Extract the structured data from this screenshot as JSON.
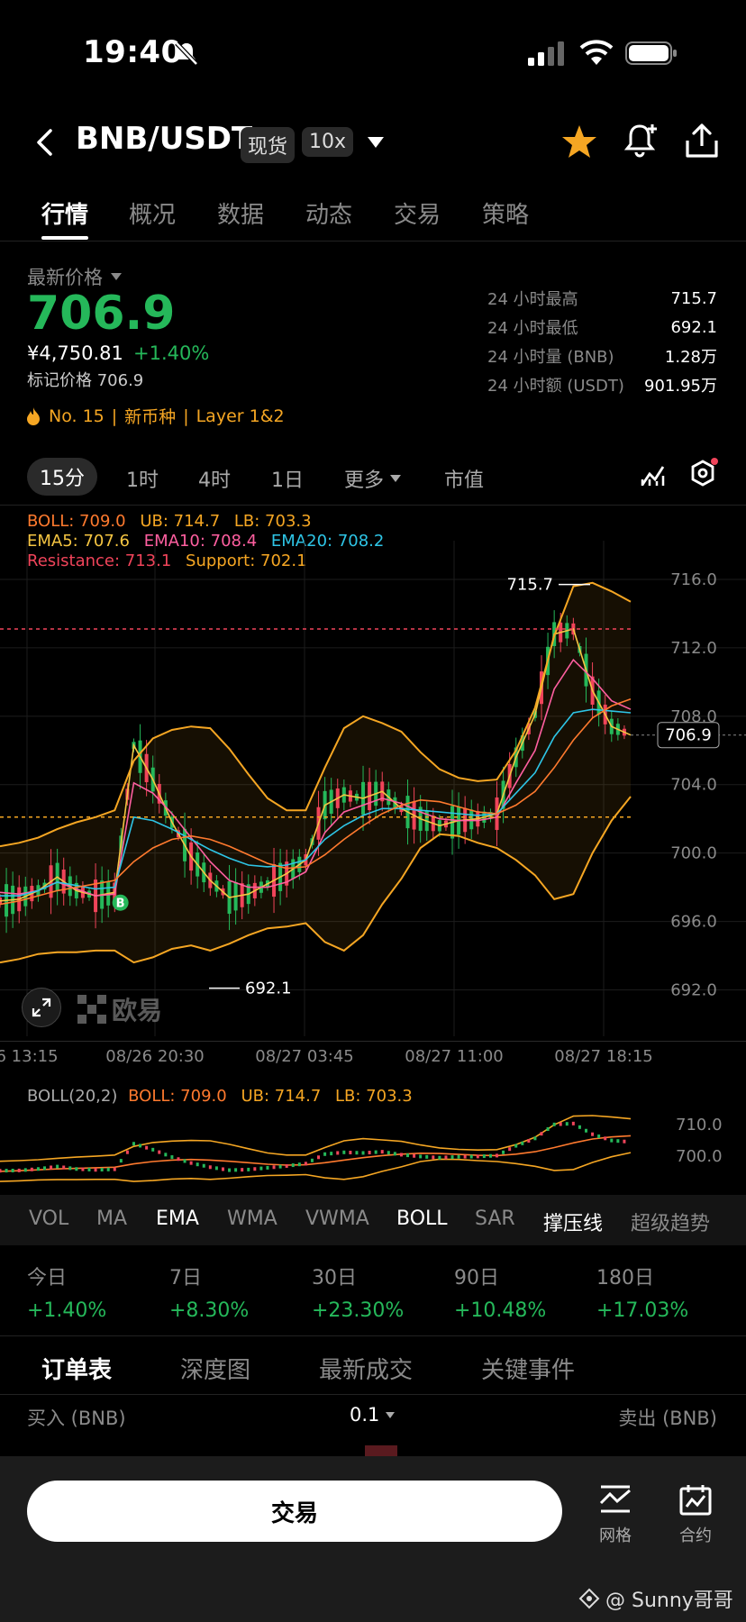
{
  "status_bar": {
    "time": "19:40"
  },
  "header": {
    "pair": "BNB/USDT",
    "badge_spot": "现货",
    "badge_leverage": "10x"
  },
  "tabs": [
    {
      "label": "行情",
      "active": true
    },
    {
      "label": "概况"
    },
    {
      "label": "数据"
    },
    {
      "label": "动态"
    },
    {
      "label": "交易"
    },
    {
      "label": "策略"
    }
  ],
  "price": {
    "label": "最新价格",
    "value": "706.9",
    "cny": "¥4,750.81",
    "change": "+1.40%",
    "mark": "标记价格 706.9",
    "tags": [
      "No. 15",
      "新币种",
      "Layer 1&2"
    ]
  },
  "stats": [
    {
      "label": "24 小时最高",
      "value": "715.7"
    },
    {
      "label": "24 小时最低",
      "value": "692.1"
    },
    {
      "label": "24 小时量 (BNB)",
      "value": "1.28万"
    },
    {
      "label": "24 小时额 (USDT)",
      "value": "901.95万"
    }
  ],
  "timeframes": {
    "active": "15分",
    "items": [
      "1时",
      "4时",
      "1日"
    ],
    "more": "更多",
    "mcap": "市值"
  },
  "legend": {
    "boll": "BOLL: 709.0",
    "ub": "UB: 714.7",
    "lb": "LB: 703.3",
    "ema5": "EMA5: 707.6",
    "ema10": "EMA10: 708.4",
    "ema20": "EMA20: 708.2",
    "resistance": "Resistance: 713.1",
    "support": "Support: 702.1"
  },
  "chart_data": {
    "type": "line",
    "y_ticks": [
      "716.0",
      "712.0",
      "708.0",
      "704.0",
      "700.0",
      "696.0",
      "692.0"
    ],
    "ylim": [
      691.5,
      717
    ],
    "x_ticks": [
      "6 13:15",
      "08/26 20:30",
      "08/27 03:45",
      "08/27 11:00",
      "08/27 18:15"
    ],
    "high_label": "715.7",
    "low_label": "692.1",
    "current_price": "706.9",
    "resistance": 713.1,
    "support": 702.1,
    "series": [
      {
        "name": "EMA5",
        "color": "#f5c542",
        "values": [
          697.2,
          697.3,
          697.8,
          698.6,
          697.8,
          697.5,
          697.7,
          706.3,
          704.3,
          701.8,
          699.8,
          698.4,
          697.4,
          697.6,
          698.2,
          698.8,
          699.6,
          702.8,
          703.4,
          703.2,
          703.6,
          702.6,
          702.0,
          701.6,
          701.9,
          702.0,
          702.3,
          705.6,
          708.1,
          712.8,
          713.1,
          709.5,
          707.4,
          706.9
        ]
      },
      {
        "name": "EMA10",
        "color": "#ff5fa0",
        "values": [
          697.7,
          697.6,
          697.8,
          698.3,
          697.9,
          697.5,
          697.6,
          704.1,
          703.5,
          702.3,
          700.9,
          699.5,
          698.4,
          698.0,
          698.0,
          698.3,
          698.9,
          701.2,
          702.4,
          702.8,
          703.2,
          702.9,
          702.4,
          702.0,
          701.9,
          701.9,
          702.1,
          704.1,
          706.0,
          709.6,
          711.3,
          710.2,
          708.9,
          708.4
        ]
      },
      {
        "name": "EMA20",
        "color": "#2ec5e6",
        "values": [
          697.5,
          697.5,
          697.8,
          698.3,
          698.1,
          697.9,
          698.0,
          702.1,
          701.9,
          701.4,
          700.8,
          700.2,
          699.7,
          699.3,
          699.2,
          699.3,
          699.6,
          700.8,
          701.6,
          702.2,
          702.6,
          702.6,
          702.5,
          702.4,
          702.3,
          702.2,
          702.3,
          703.5,
          704.7,
          706.8,
          708.2,
          708.4,
          708.3,
          708.2
        ]
      },
      {
        "name": "BOLL",
        "color": "#ff7a2e",
        "values": [
          697.0,
          697.2,
          697.5,
          697.8,
          698.0,
          698.2,
          698.4,
          699.5,
          700.3,
          700.8,
          701.0,
          700.8,
          700.4,
          699.9,
          699.4,
          699.1,
          699.2,
          699.9,
          700.8,
          701.6,
          702.3,
          702.8,
          703.1,
          703.0,
          702.7,
          702.4,
          702.3,
          702.8,
          703.6,
          705.0,
          706.6,
          707.9,
          708.6,
          709.0
        ]
      },
      {
        "name": "UB",
        "color": "#f5a623",
        "values": [
          700.4,
          700.6,
          700.9,
          701.4,
          701.8,
          702.1,
          702.5,
          705.4,
          706.7,
          707.2,
          707.4,
          707.3,
          706.1,
          704.6,
          703.2,
          702.5,
          702.5,
          705.0,
          707.3,
          708.0,
          707.6,
          707.1,
          705.9,
          704.9,
          704.4,
          704.2,
          704.3,
          706.0,
          708.5,
          712.7,
          715.6,
          715.8,
          715.3,
          714.7
        ]
      },
      {
        "name": "LB",
        "color": "#f5a623",
        "values": [
          693.6,
          693.8,
          694.1,
          694.2,
          694.2,
          694.3,
          694.3,
          693.6,
          693.9,
          694.4,
          694.6,
          694.3,
          694.7,
          695.2,
          695.6,
          695.7,
          695.9,
          694.8,
          694.3,
          695.2,
          697.0,
          698.5,
          700.3,
          701.1,
          701.0,
          700.6,
          700.3,
          699.6,
          698.7,
          697.3,
          697.6,
          700.0,
          701.9,
          703.3
        ]
      }
    ]
  },
  "sub_indicator": {
    "name": "BOLL(20,2)",
    "boll": "BOLL: 709.0",
    "ub": "UB: 714.7",
    "lb": "LB: 703.3",
    "ticks": [
      "710.0",
      "700.0"
    ]
  },
  "indicator_tabs": [
    {
      "label": "VOL"
    },
    {
      "label": "MA"
    },
    {
      "label": "EMA",
      "active": true
    },
    {
      "label": "WMA"
    },
    {
      "label": "VWMA"
    },
    {
      "label": "BOLL",
      "active": true
    },
    {
      "label": "SAR"
    },
    {
      "label": "撑压线",
      "active": true
    },
    {
      "label": "超级趋势"
    }
  ],
  "performance": [
    {
      "label": "今日",
      "value": "+1.40%"
    },
    {
      "label": "7日",
      "value": "+8.30%"
    },
    {
      "label": "30日",
      "value": "+23.30%"
    },
    {
      "label": "90日",
      "value": "+10.48%"
    },
    {
      "label": "180日",
      "value": "+17.03%"
    }
  ],
  "orderbook_tabs": [
    {
      "label": "订单表",
      "active": true
    },
    {
      "label": "深度图"
    },
    {
      "label": "最新成交"
    },
    {
      "label": "关键事件"
    }
  ],
  "orderbook": {
    "buy": "买入 (BNB)",
    "step": "0.1",
    "sell": "卖出 (BNB)"
  },
  "bottom": {
    "trade_button": "交易",
    "grid": "网格",
    "contract": "合约",
    "watermark": "@ Sunny哥哥",
    "brand": "欧易"
  }
}
